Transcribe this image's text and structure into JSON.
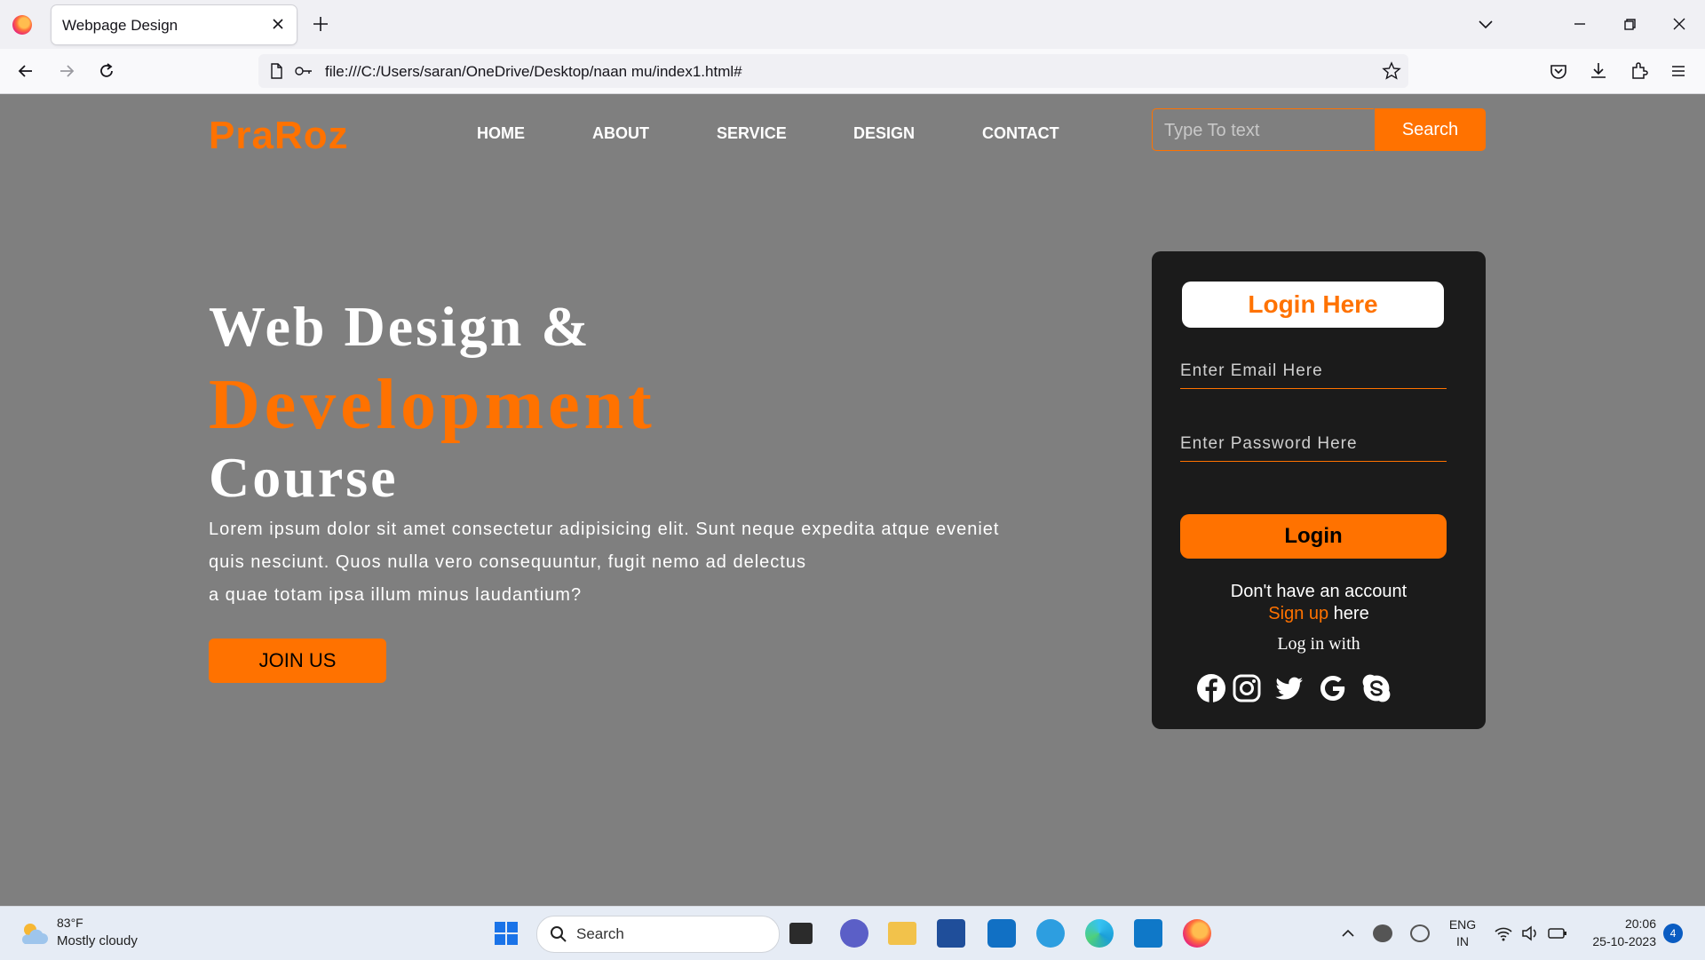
{
  "browser": {
    "tab_title": "Webpage Design",
    "url": "file:///C:/Users/saran/OneDrive/Desktop/naan mu/index1.html#"
  },
  "site": {
    "logo": "PraRoz",
    "nav": [
      "HOME",
      "ABOUT",
      "SERVICE",
      "DESIGN",
      "CONTACT"
    ],
    "search_placeholder": "Type To text",
    "search_button": "Search"
  },
  "hero": {
    "line1": "Web Design &",
    "line2": "Development",
    "line3": "Course",
    "para_line1": "Lorem ipsum dolor sit amet consectetur adipisicing elit. Sunt neque expedita atque eveniet",
    "para_line2": "quis nesciunt. Quos nulla vero consequuntur, fugit nemo ad delectus",
    "para_line3": "a quae totam ipsa illum minus laudantium?",
    "join_button": "JOIN US"
  },
  "login": {
    "title": "Login Here",
    "email_placeholder": "Enter Email Here",
    "password_placeholder": "Enter Password Here",
    "button": "Login",
    "no_account": "Don't have an account",
    "signup_link": "Sign up",
    "signup_suffix": " here",
    "login_with": "Log in with",
    "socials": [
      "facebook-icon",
      "instagram-icon",
      "twitter-icon",
      "google-icon",
      "skype-icon"
    ]
  },
  "taskbar": {
    "temperature": "83°F",
    "weather": "Mostly cloudy",
    "search": "Search",
    "lang_top": "ENG",
    "lang_bottom": "IN",
    "time": "20:06",
    "date": "25-10-2023",
    "notifications": "4"
  },
  "colors": {
    "accent": "#ff7200",
    "page_bg": "#7f7f7f",
    "panel_bg": "#1b1b1b"
  }
}
